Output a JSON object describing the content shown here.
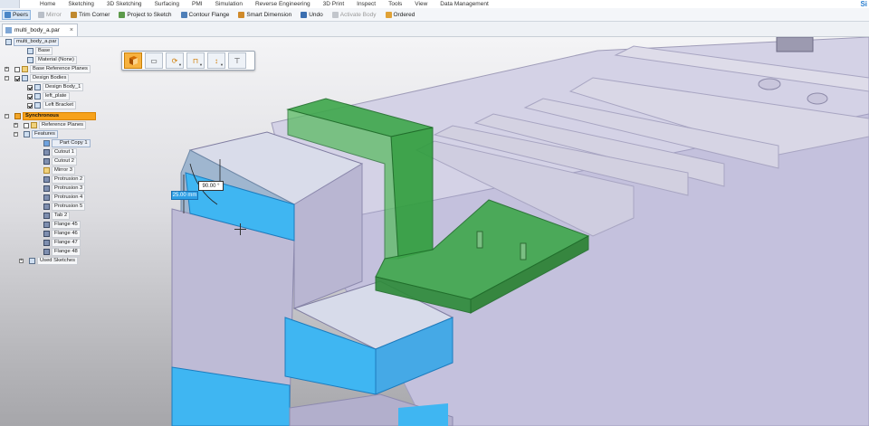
{
  "menu": {
    "items": [
      "Home",
      "Sketching",
      "3D Sketching",
      "Surfacing",
      "PMI",
      "Simulation",
      "Reverse Engineering",
      "3D Print",
      "Inspect",
      "Tools",
      "View",
      "Data Management"
    ],
    "brand": "Si"
  },
  "toolbar": {
    "items": [
      {
        "label": "Peers",
        "icon": "peers-icon",
        "active": true,
        "disabled": false
      },
      {
        "label": "Mirror",
        "icon": "mirror-icon",
        "active": false,
        "disabled": true
      },
      {
        "label": "Trim Corner",
        "icon": "trim-corner-icon",
        "active": false,
        "disabled": false
      },
      {
        "label": "Project to Sketch",
        "icon": "project-icon",
        "active": false,
        "disabled": false
      },
      {
        "label": "Contour Flange",
        "icon": "contour-flange-icon",
        "active": false,
        "disabled": false
      },
      {
        "label": "Smart Dimension",
        "icon": "smart-dimension-icon",
        "active": false,
        "disabled": false
      },
      {
        "label": "Undo",
        "icon": "undo-icon",
        "active": false,
        "disabled": false
      },
      {
        "label": "Activate Body",
        "icon": "activate-body-icon",
        "active": false,
        "disabled": true
      },
      {
        "label": "Ordered",
        "icon": "ordered-icon",
        "active": false,
        "disabled": false
      }
    ]
  },
  "document": {
    "tab_label": "multi_body_a.par",
    "close_glyph": "×"
  },
  "tree": {
    "items": [
      {
        "label": "multi_body_a.par",
        "icon": "part-file-icon"
      },
      {
        "label": "Base",
        "icon": "base-icon"
      },
      {
        "label": "Material (None)",
        "icon": "material-icon"
      },
      {
        "label": "Base Reference Planes",
        "icon": "planes-icon"
      },
      {
        "label": "Design Bodies",
        "icon": "design-bodies-icon"
      },
      {
        "label": "Design Body_1",
        "icon": "body-icon"
      },
      {
        "label": "left_plate",
        "icon": "body-icon"
      },
      {
        "label": "Left Bracket",
        "icon": "body-icon"
      },
      {
        "label": "Synchronous",
        "icon": "synchronous-icon"
      },
      {
        "label": "Reference Planes",
        "icon": "planes-icon"
      },
      {
        "label": "Features",
        "icon": "features-icon"
      },
      {
        "label": "Part Copy 1",
        "icon": "part-copy-icon"
      },
      {
        "label": "Cutout 1",
        "icon": "cutout-icon"
      },
      {
        "label": "Cutout 2",
        "icon": "cutout-icon"
      },
      {
        "label": "Mirror 3",
        "icon": "mirror-icon"
      },
      {
        "label": "Protrusion 2",
        "icon": "protrusion-icon"
      },
      {
        "label": "Protrusion 3",
        "icon": "protrusion-icon"
      },
      {
        "label": "Protrusion 4",
        "icon": "protrusion-icon"
      },
      {
        "label": "Protrusion 5",
        "icon": "protrusion-icon"
      },
      {
        "label": "Tab 2",
        "icon": "tab-icon"
      },
      {
        "label": "Flange 45",
        "icon": "flange-icon"
      },
      {
        "label": "Flange 46",
        "icon": "flange-icon"
      },
      {
        "label": "Flange 47",
        "icon": "flange-icon"
      },
      {
        "label": "Flange 48",
        "icon": "flange-icon"
      },
      {
        "label": "Used Sketches",
        "icon": "sketches-icon"
      }
    ]
  },
  "command_bar": {
    "buttons": [
      {
        "name": "select-face-icon",
        "glyph": ""
      },
      {
        "name": "face-priority-icon",
        "glyph": "▭"
      },
      {
        "name": "rotate-icon",
        "glyph": "⟳"
      },
      {
        "name": "dimension-icon",
        "glyph": "⊓"
      },
      {
        "name": "move-icon",
        "glyph": "↕"
      },
      {
        "name": "flange-tool-icon",
        "glyph": "⊤"
      }
    ]
  },
  "dimensions": {
    "angle": "90.00 °",
    "length": "25.00 mm"
  },
  "colors": {
    "selected_face": "#3fb6f2",
    "green_bracket": "#2f9e3c",
    "body_gray": "#c5c2dc",
    "tree_selected": "#f7a21b",
    "toolbar_active": "#d6e6f7"
  }
}
